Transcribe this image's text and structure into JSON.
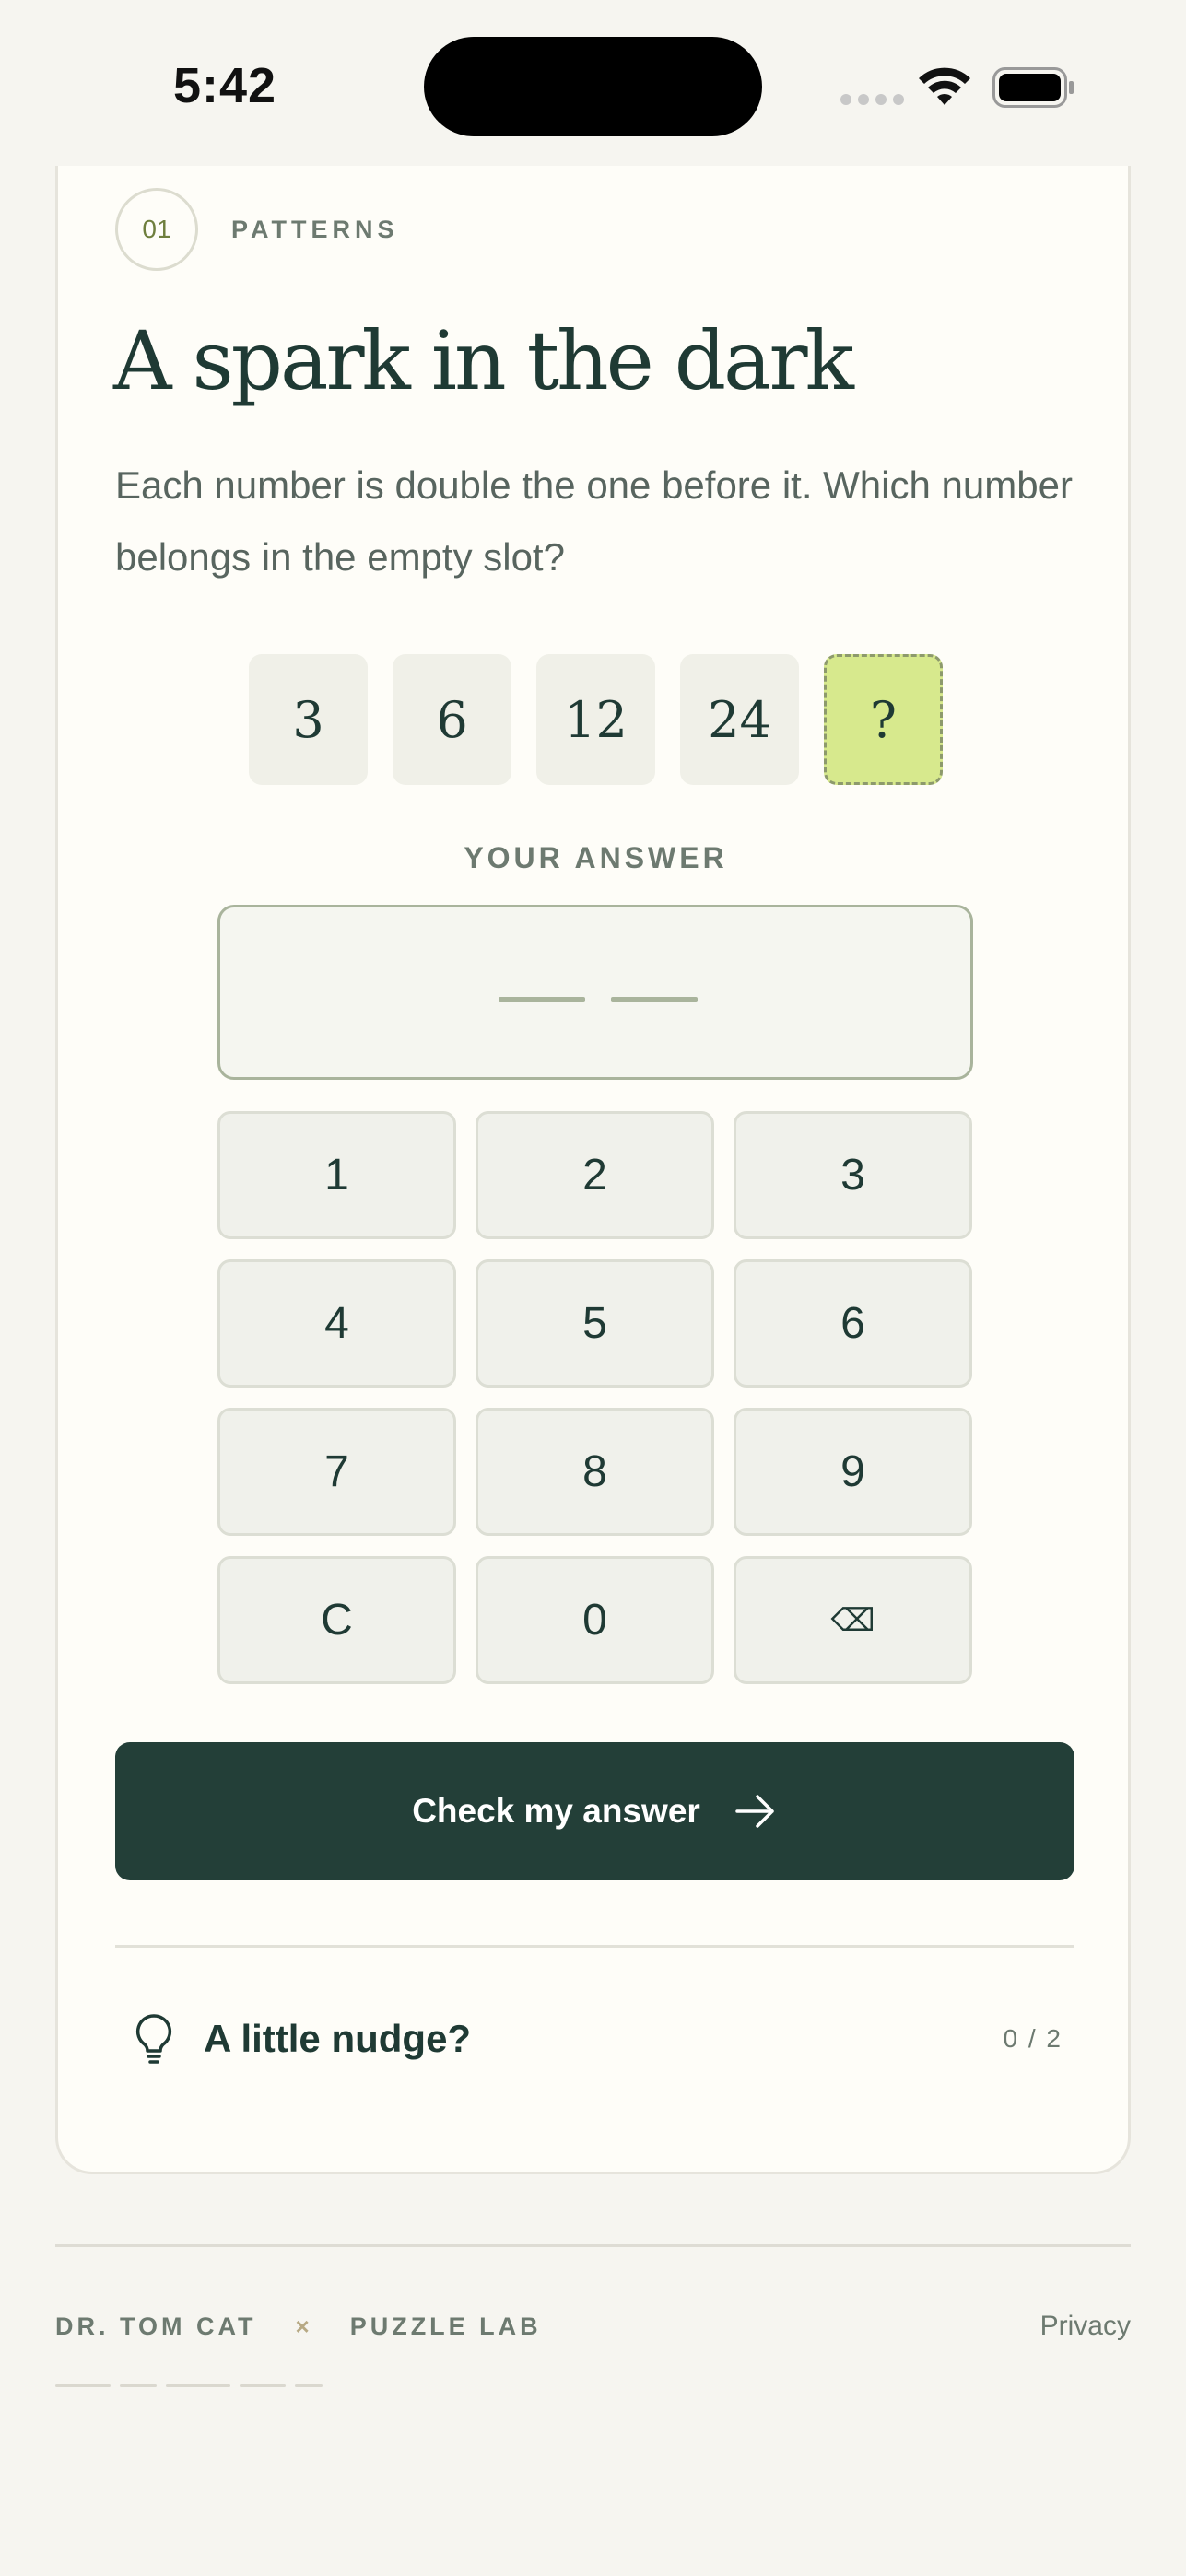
{
  "status_bar": {
    "time": "5:42"
  },
  "puzzle": {
    "number": "01",
    "category": "PATTERNS",
    "title": "A spark in the dark",
    "prompt": "Each number is double the one before it. Which number belongs in the empty slot?",
    "sequence": [
      "3",
      "6",
      "12",
      "24",
      "?"
    ],
    "answer_label": "YOUR ANSWER"
  },
  "keypad": {
    "keys": [
      "1",
      "2",
      "3",
      "4",
      "5",
      "6",
      "7",
      "8",
      "9",
      "C",
      "0",
      "⌫"
    ]
  },
  "actions": {
    "check_label": "Check my answer"
  },
  "hint": {
    "label": "A little nudge?",
    "count": "0 / 2"
  },
  "footer": {
    "brand_left": "DR. TOM CAT",
    "separator": "×",
    "brand_right": "PUZZLE LAB",
    "privacy": "Privacy"
  },
  "colors": {
    "accent_dark": "#233f38",
    "highlight": "#d7e98d",
    "background": "#f6f5f0"
  }
}
